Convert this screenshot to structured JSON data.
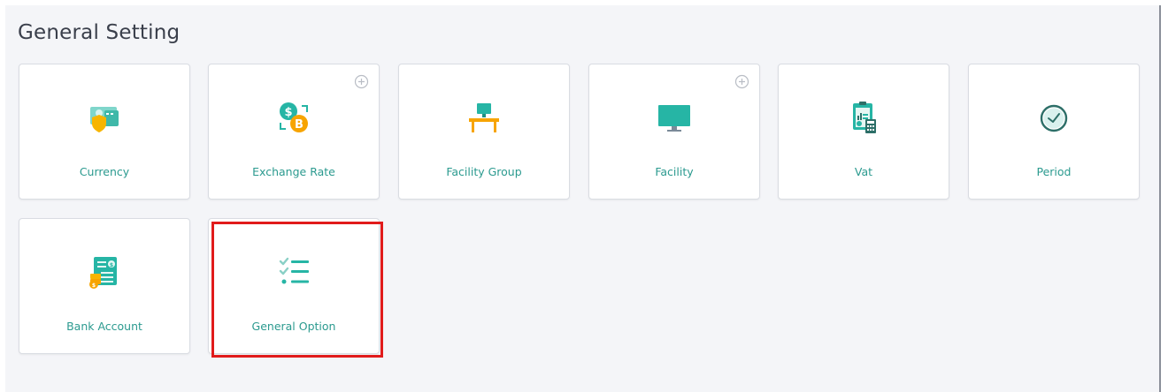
{
  "page": {
    "title": "General Setting"
  },
  "cards": [
    {
      "label": "Currency",
      "icon": "currency-shield-icon",
      "has_add": false
    },
    {
      "label": "Exchange Rate",
      "icon": "exchange-rate-icon",
      "has_add": true
    },
    {
      "label": "Facility Group",
      "icon": "desk-computer-icon",
      "has_add": false
    },
    {
      "label": "Facility",
      "icon": "monitor-icon",
      "has_add": true
    },
    {
      "label": "Vat",
      "icon": "clipboard-calculator-icon",
      "has_add": false
    },
    {
      "label": "Period",
      "icon": "clock-icon",
      "has_add": false
    },
    {
      "label": "Bank Account",
      "icon": "bank-statement-coins-icon",
      "has_add": false
    },
    {
      "label": "General Option",
      "icon": "checklist-icon",
      "has_add": false
    }
  ],
  "colors": {
    "accent": "#2b9a8f",
    "teal_icon": "#26b5a5",
    "highlight": "#e11b1b",
    "panel_bg": "#f4f5f8"
  }
}
